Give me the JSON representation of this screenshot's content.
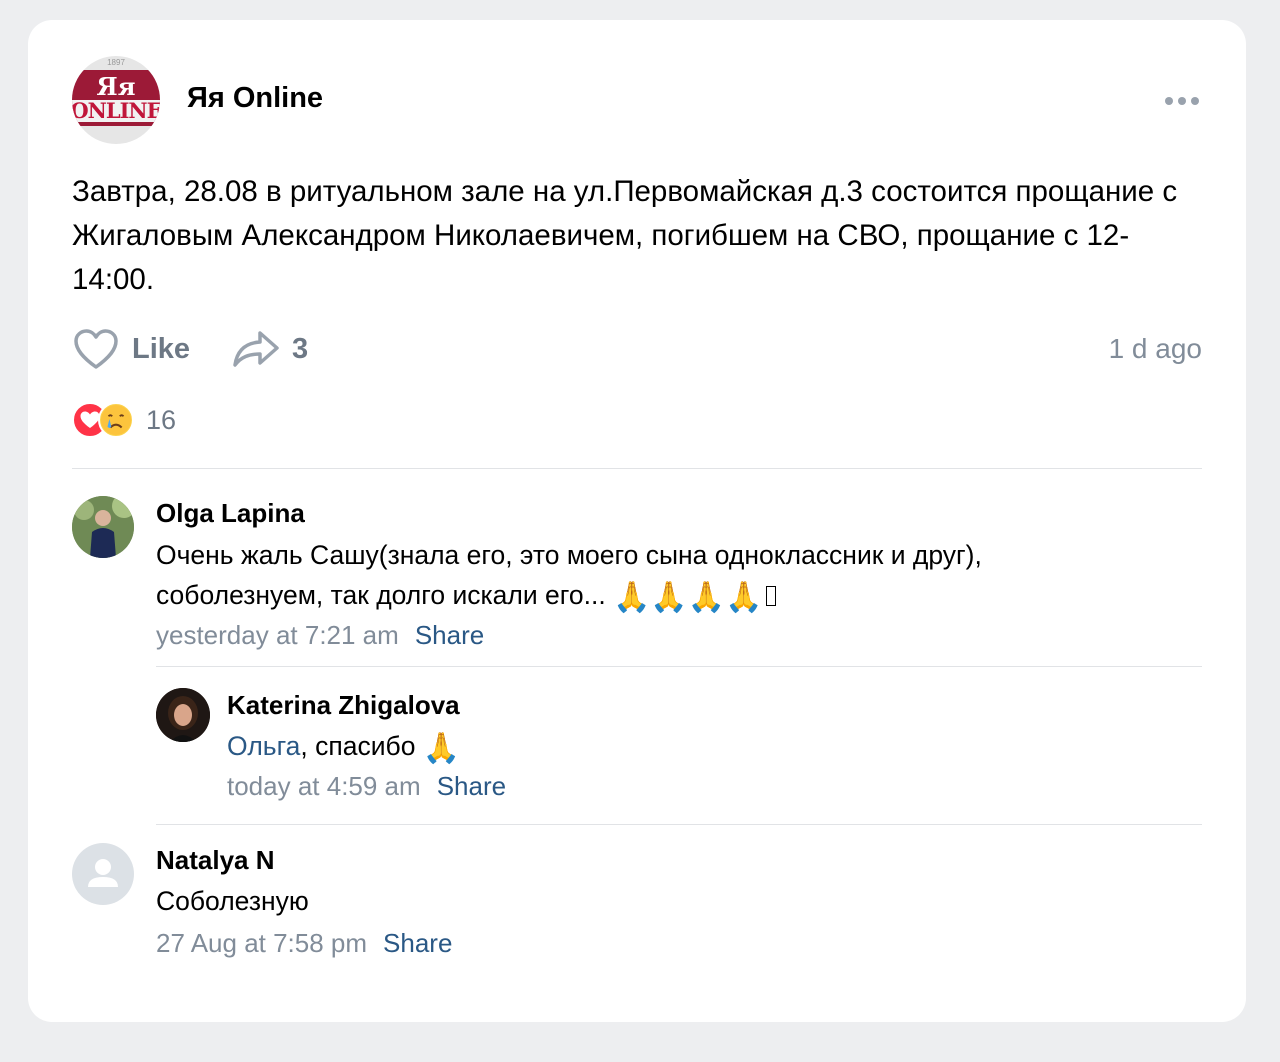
{
  "post": {
    "author": "Яя Online",
    "logo_text_top": "Яя",
    "logo_text_bottom": "ONLINE",
    "logo_year": "1897",
    "text": "Завтра, 28.08 в ритуальном зале на ул.Первомайская д.3 состоится прощание с Жигаловым Александром Николаевичем, погибшем на СВО, прощание с 12-14:00.",
    "like_label": "Like",
    "share_count": "3",
    "time_ago": "1 d ago",
    "reactions": [
      "heart",
      "crying-face"
    ],
    "reaction_count": "16"
  },
  "comments": [
    {
      "author": "Olga Lapina",
      "text": "Очень жаль Сашу(знала его, это моего сына одноклассник и друг), соболезнуем, так долго искали его...",
      "emoji": "🙏🙏🙏🙏",
      "time": "yesterday at 7:21 am",
      "share_label": "Share"
    },
    {
      "author": "Katerina Zhigalova",
      "mention": "Ольга",
      "text": ", спасибо",
      "emoji": "🙏",
      "time": "today at 4:59 am",
      "share_label": "Share"
    },
    {
      "author": "Natalya N",
      "text": "Соболезную",
      "time": "27 Aug at 7:58 pm",
      "share_label": "Share"
    }
  ],
  "colors": {
    "background": "#edeef0",
    "link": "#2a5885",
    "secondary_text": "#818c99",
    "logo_brand": "#9c1a37",
    "heart": "#ff3347"
  }
}
